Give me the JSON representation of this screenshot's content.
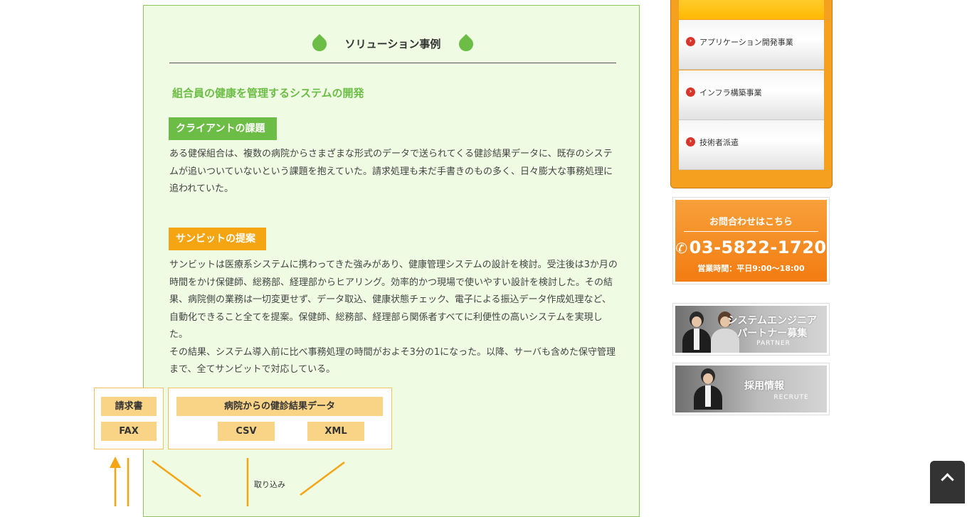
{
  "section": {
    "title": "ソリューション事例",
    "case_heading": "組合員の健康を管理するシステムの開発"
  },
  "client_issue": {
    "label": "クライアントの課題",
    "text": "ある健保組合は、複数の病院からさまざまな形式のデータで送られてくる健診結果データに、既存のシステムが追いついていないという課題を抱えていた。請求処理も未だ手書きのもの多く、日々膨大な事務処理に追われていた。"
  },
  "proposal": {
    "label": "サンビットの提案",
    "paragraphs": [
      "サンビットは医療系システムに携わってきた強みがあり、健康管理システムの設計を検討。受注後は3か月の時間をかけ保健師、総務部、経理部からヒアリング。効率的かつ現場で使いやすい設計を検討した。その結果、病院側の業務は一切変更せず、データ取込、健康状態チェック、電子による振込データ作成処理など、自動化できること全てを提案。保健師、総務部、経理部ら関係者すべてに利便性の高いシステムを実現した。",
      "その結果、システム導入前に比べ事務処理の時間がおよそ3分の1になった。以降、サーバも含めた保守管理まで、全てサンビットで対応している。"
    ]
  },
  "diagram": {
    "seikyu": "請求書",
    "fax": "FAX",
    "data": "病院からの健診結果データ",
    "csv": "CSV",
    "xml": "XML",
    "torikomi": "取り込み"
  },
  "sidebar": {
    "menu": [
      {
        "label": "アプリケーション開発事業"
      },
      {
        "label": "インフラ構築事業"
      },
      {
        "label": "技術者派遣"
      }
    ],
    "contact": {
      "title": "お問合わせはこちら",
      "phone": "03-5822-1720",
      "hours": "営業時間：平日9:00～18:00"
    },
    "partner": {
      "title_1": "システムエンジニア",
      "title_2": "パートナー募集",
      "sub": "PARTNER"
    },
    "recruit": {
      "title": "採用情報",
      "sub": "RECRUTE"
    }
  },
  "colors": {
    "green": "#6cbd45",
    "orange": "#f5a412",
    "panel_bg": "#effbe3"
  }
}
